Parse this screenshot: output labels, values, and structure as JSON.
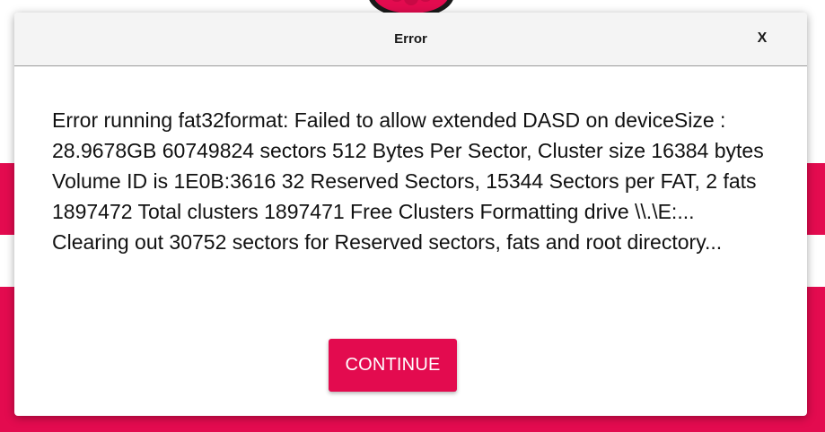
{
  "app": {
    "logo_icon": "raspberry-pi-logo-icon",
    "colors": {
      "accent": "#e30b4f",
      "background": "#ffffff"
    }
  },
  "dialog": {
    "title": "Error",
    "close_label": "X",
    "message": "Error running fat32format: Failed to allow extended DASD on deviceSize : 28.9678GB 60749824 sectors 512 Bytes Per Sector, Cluster size 16384 bytes Volume ID is 1E0B:3616 32 Reserved Sectors, 15344 Sectors per FAT, 2 fats 1897472 Total clusters 1897471 Free Clusters Formatting drive \\\\.\\E:... Clearing out 30752 sectors for Reserved sectors, fats and root directory...",
    "continue_label": "CONTINUE"
  }
}
